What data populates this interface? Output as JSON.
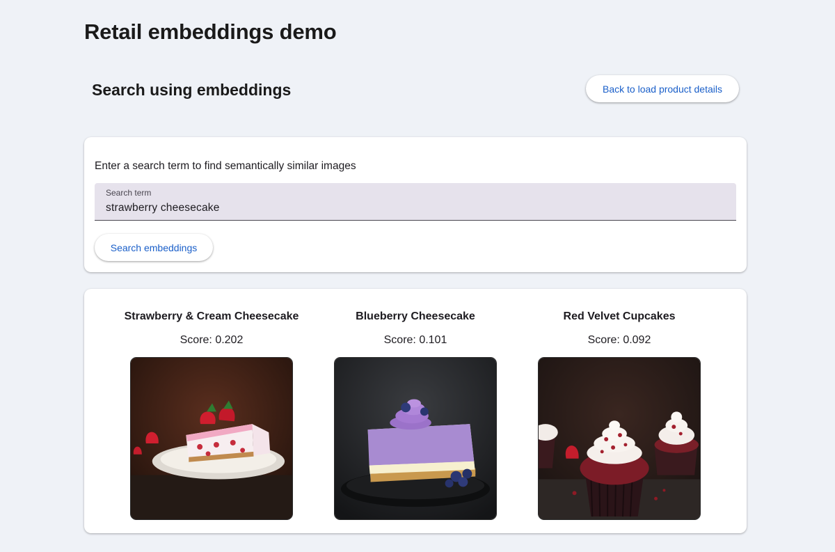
{
  "app": {
    "title": "Retail embeddings demo"
  },
  "header": {
    "section_title": "Search using embeddings",
    "back_button_label": "Back to load product details"
  },
  "search": {
    "hint": "Enter a search term to find semantically similar images",
    "field_label": "Search term",
    "value": "strawberry cheesecake",
    "button_label": "Search embeddings"
  },
  "results": [
    {
      "title": "Strawberry & Cream Cheesecake",
      "score": "Score: 0.202",
      "image": "strawberry-cheesecake-image"
    },
    {
      "title": "Blueberry Cheesecake",
      "score": "Score: 0.101",
      "image": "blueberry-cheesecake-image"
    },
    {
      "title": "Red Velvet Cupcakes",
      "score": "Score: 0.092",
      "image": "red-velvet-cupcakes-image"
    }
  ],
  "colors": {
    "background": "#eff2f7",
    "card": "#ffffff",
    "button_text": "#1a5fc9",
    "field_fill": "#e6e2ec"
  }
}
